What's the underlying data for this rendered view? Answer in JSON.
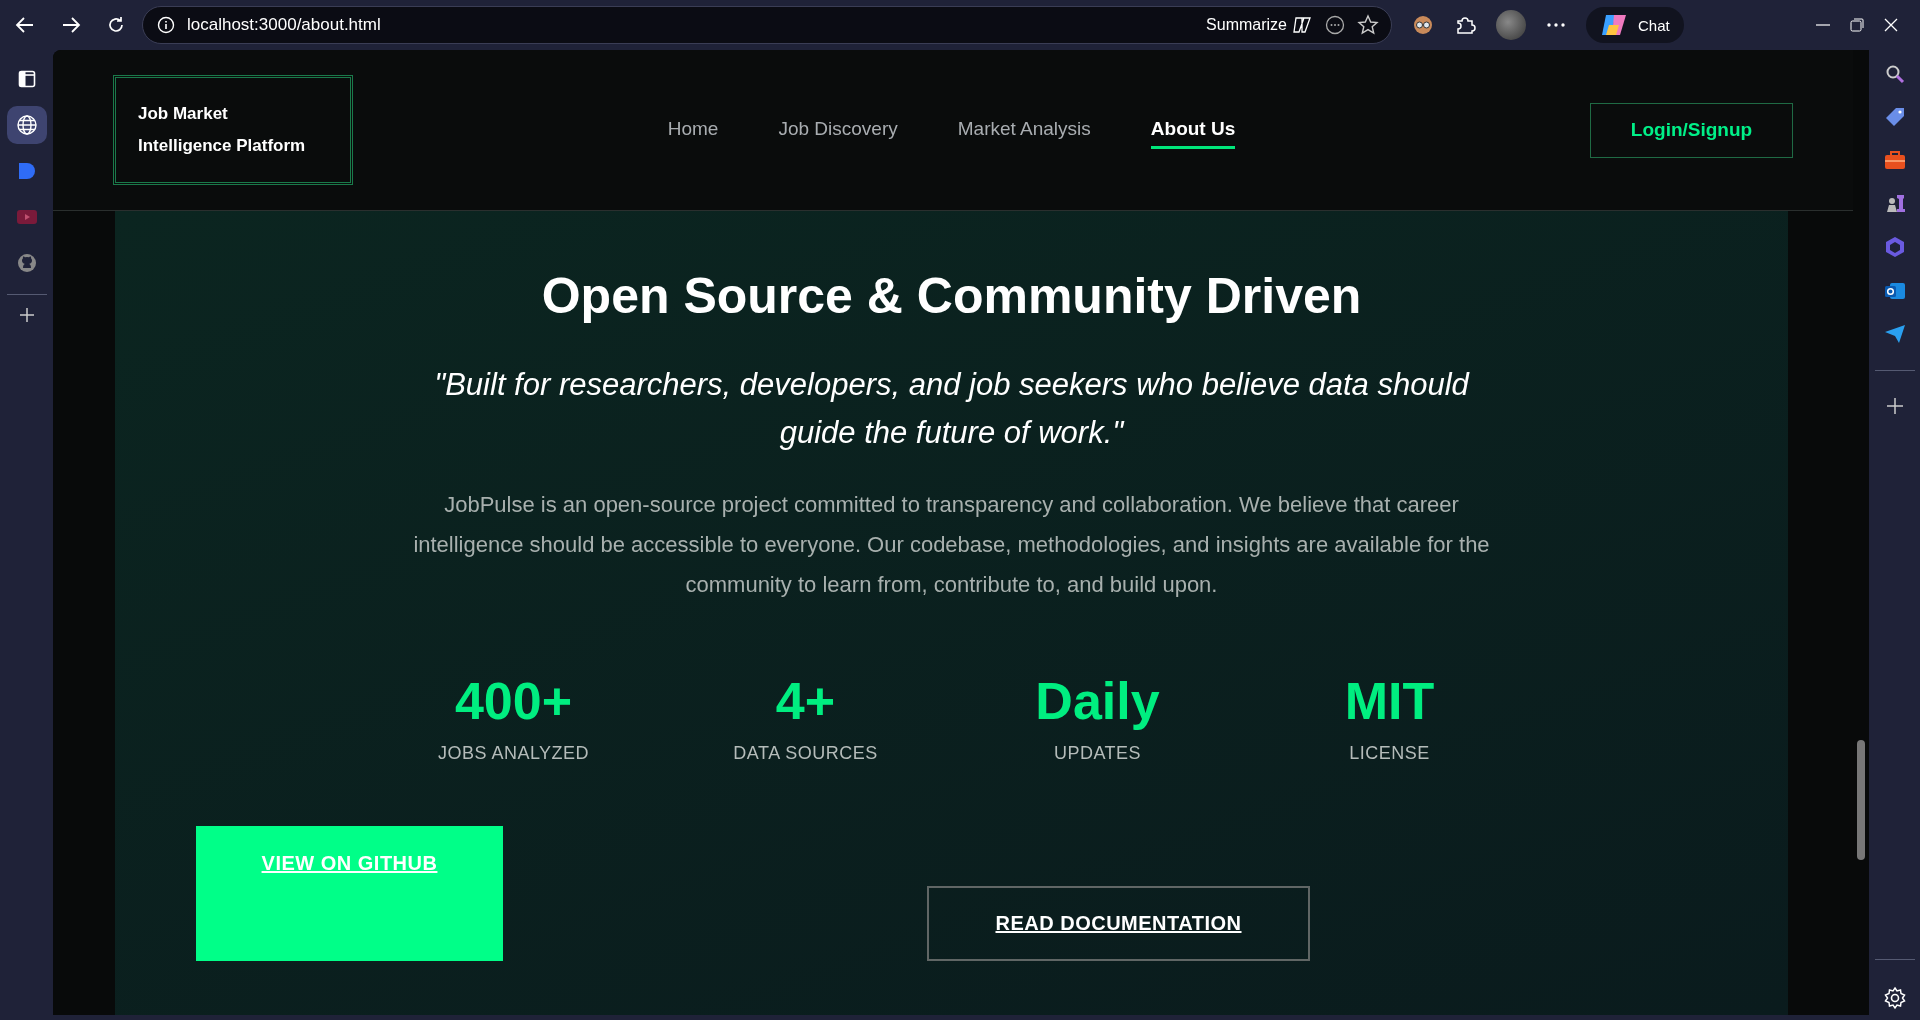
{
  "browser": {
    "address": "localhost:3000/about.html",
    "summarize": "Summarize",
    "chat": "Chat",
    "left_sidebar": [
      {
        "kind": "tabs",
        "selected": false
      },
      {
        "kind": "globe",
        "selected": true
      },
      {
        "kind": "note",
        "selected": false
      },
      {
        "kind": "video",
        "selected": false
      },
      {
        "kind": "github",
        "selected": false
      }
    ]
  },
  "header": {
    "logo": "Job Market Intelligence Platform",
    "nav": [
      {
        "label": "Home",
        "selected": false
      },
      {
        "label": "Job Discovery",
        "selected": false
      },
      {
        "label": "Market Analysis",
        "selected": false
      },
      {
        "label": "About Us",
        "selected": true
      }
    ],
    "login": "Login/Signup"
  },
  "section": {
    "title": "Open Source & Community Driven",
    "quote": "\"Built for researchers, developers, and job seekers who believe data should guide the future of work.\"",
    "paragraph": "JobPulse is an open-source project committed to transparency and collaboration. We believe that career intelligence should be accessible to everyone. Our codebase, methodologies, and insights are available for the community to learn from, contribute to, and build upon.",
    "stats": [
      {
        "value": "400+",
        "label": "JOBS ANALYZED"
      },
      {
        "value": "4+",
        "label": "DATA SOURCES"
      },
      {
        "value": "Daily",
        "label": "UPDATES"
      },
      {
        "value": "MIT",
        "label": "LICENSE"
      }
    ],
    "buttons": [
      {
        "label": "VIEW ON GITHUB",
        "kind": "primary"
      },
      {
        "label": "READ DOCUMENTATION",
        "kind": "outline"
      }
    ]
  }
}
